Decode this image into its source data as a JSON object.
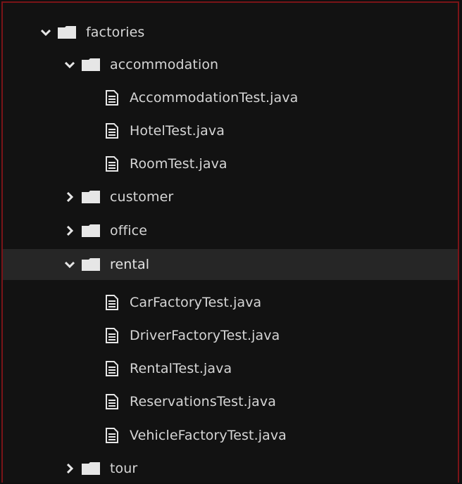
{
  "tree": {
    "root": {
      "label": "factories",
      "expanded": true
    },
    "accommodation": {
      "label": "accommodation",
      "expanded": true,
      "files": [
        "AccommodationTest.java",
        "HotelTest.java",
        "RoomTest.java"
      ]
    },
    "customer": {
      "label": "customer",
      "expanded": false
    },
    "office": {
      "label": "office",
      "expanded": false
    },
    "rental": {
      "label": "rental",
      "expanded": true,
      "selected": true,
      "files": [
        "CarFactoryTest.java",
        "DriverFactoryTest.java",
        "RentalTest.java",
        "ReservationsTest.java",
        "VehicleFactoryTest.java"
      ]
    },
    "tour": {
      "label": "tour",
      "expanded": false
    }
  },
  "colors": {
    "background": "#121212",
    "selected_row": "#262626",
    "border_accent": "#7a1418",
    "text": "#d6d6d6",
    "icon": "#e6e6e6"
  },
  "icons": {
    "expanded": "chevron-down-icon",
    "collapsed": "chevron-right-icon",
    "folder": "folder-icon",
    "file": "file-icon"
  }
}
